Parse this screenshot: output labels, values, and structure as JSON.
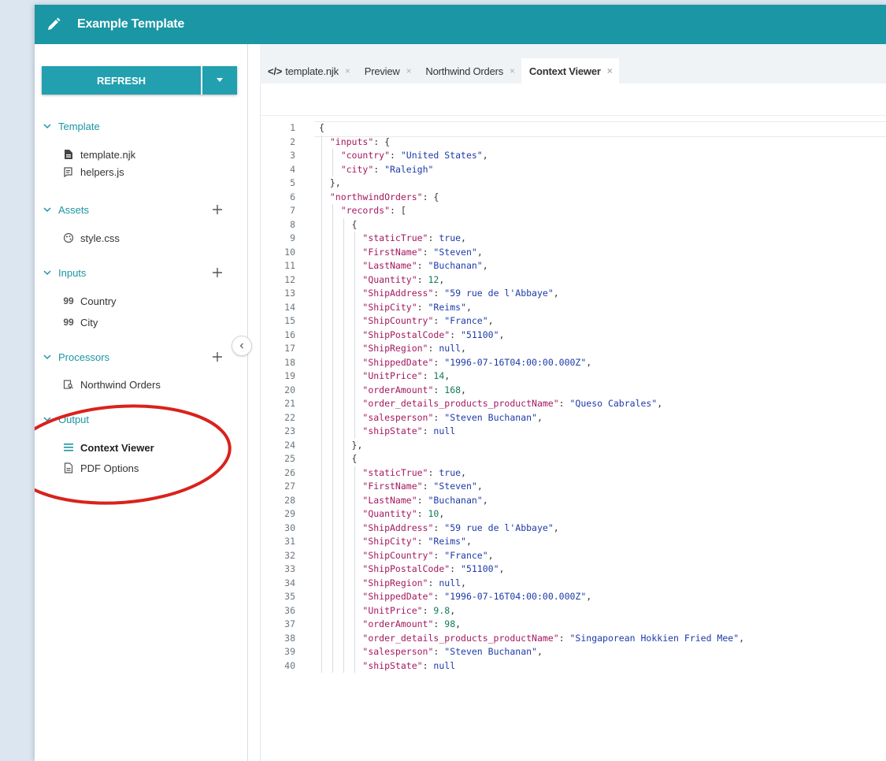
{
  "app": {
    "title": "Example Template"
  },
  "sidebar": {
    "refresh_label": "REFRESH",
    "sections": {
      "template": {
        "label": "Template",
        "items": [
          {
            "label": "template.njk",
            "icon": "file-icon"
          },
          {
            "label": "helpers.js",
            "icon": "script-icon"
          }
        ]
      },
      "assets": {
        "label": "Assets",
        "items": [
          {
            "label": "style.css",
            "icon": "palette-icon"
          }
        ]
      },
      "inputs": {
        "label": "Inputs",
        "items": [
          {
            "label": "Country",
            "icon": "quote-icon"
          },
          {
            "label": "City",
            "icon": "quote-icon"
          }
        ]
      },
      "processors": {
        "label": "Processors",
        "items": [
          {
            "label": "Northwind Orders",
            "icon": "database-icon"
          }
        ]
      },
      "output": {
        "label": "Output",
        "items": [
          {
            "label": "Context Viewer",
            "icon": "list-icon",
            "active": true
          },
          {
            "label": "PDF Options",
            "icon": "document-icon"
          }
        ]
      }
    }
  },
  "tabs": [
    {
      "label": "template.njk",
      "icon": "code-icon",
      "active": false
    },
    {
      "label": "Preview",
      "active": false
    },
    {
      "label": "Northwind Orders",
      "active": false
    },
    {
      "label": "Context Viewer",
      "active": true
    }
  ],
  "tab_close_glyph": "×",
  "tab_code_glyph": "</>",
  "code_lines": [
    "{",
    "  \"inputs\": {",
    "    \"country\": \"United States\",",
    "    \"city\": \"Raleigh\"",
    "  },",
    "  \"northwindOrders\": {",
    "    \"records\": [",
    "      {",
    "        \"staticTrue\": true,",
    "        \"FirstName\": \"Steven\",",
    "        \"LastName\": \"Buchanan\",",
    "        \"Quantity\": 12,",
    "        \"ShipAddress\": \"59 rue de l'Abbaye\",",
    "        \"ShipCity\": \"Reims\",",
    "        \"ShipCountry\": \"France\",",
    "        \"ShipPostalCode\": \"51100\",",
    "        \"ShipRegion\": null,",
    "        \"ShippedDate\": \"1996-07-16T04:00:00.000Z\",",
    "        \"UnitPrice\": 14,",
    "        \"orderAmount\": 168,",
    "        \"order_details_products_productName\": \"Queso Cabrales\",",
    "        \"salesperson\": \"Steven Buchanan\",",
    "        \"shipState\": null",
    "      },",
    "      {",
    "        \"staticTrue\": true,",
    "        \"FirstName\": \"Steven\",",
    "        \"LastName\": \"Buchanan\",",
    "        \"Quantity\": 10,",
    "        \"ShipAddress\": \"59 rue de l'Abbaye\",",
    "        \"ShipCity\": \"Reims\",",
    "        \"ShipCountry\": \"France\",",
    "        \"ShipPostalCode\": \"51100\",",
    "        \"ShipRegion\": null,",
    "        \"ShippedDate\": \"1996-07-16T04:00:00.000Z\",",
    "        \"UnitPrice\": 9.8,",
    "        \"orderAmount\": 98,",
    "        \"order_details_products_productName\": \"Singaporean Hokkien Fried Mee\",",
    "        \"salesperson\": \"Steven Buchanan\",",
    "        \"shipState\": null"
  ],
  "colors": {
    "header": "#1a96a4",
    "button": "#22a0b0",
    "section_text": "#1a96a4",
    "annotation_circle": "#d9221c",
    "json_key": "#a3185f",
    "json_string": "#1d3aa8",
    "json_number": "#117a5a"
  }
}
